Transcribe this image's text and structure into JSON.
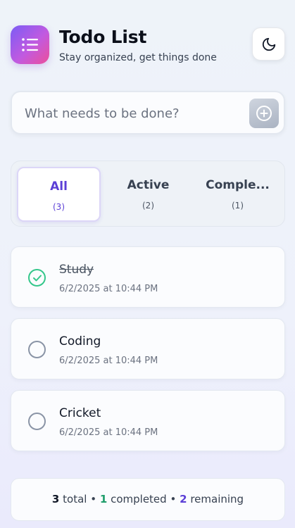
{
  "app": {
    "title": "Todo List",
    "subtitle": "Stay organized, get things done",
    "logo_icon": "list-icon",
    "theme_toggle_icon": "moon-icon"
  },
  "input": {
    "placeholder": "What needs to be done?",
    "value": "",
    "add_icon": "plus-circle-icon"
  },
  "filters": [
    {
      "label": "All",
      "count": "(3)",
      "selected": true
    },
    {
      "label": "Active",
      "count": "(2)",
      "selected": false
    },
    {
      "label": "Comple...",
      "count": "(1)",
      "selected": false
    }
  ],
  "todos": [
    {
      "text": "Study",
      "time": "6/2/2025 at 10:44 PM",
      "completed": true
    },
    {
      "text": "Coding",
      "time": "6/2/2025 at 10:44 PM",
      "completed": false
    },
    {
      "text": "Cricket",
      "time": "6/2/2025 at 10:44 PM",
      "completed": false
    }
  ],
  "stats": {
    "total": "3",
    "total_label": "total",
    "completed": "1",
    "completed_label": "completed",
    "remaining": "2",
    "remaining_label": "remaining",
    "separator": "•"
  },
  "colors": {
    "accent": "#5b3fd6",
    "completed": "#34c78b",
    "logo_gradient": [
      "#7b5cf5",
      "#ec4f9a"
    ]
  }
}
